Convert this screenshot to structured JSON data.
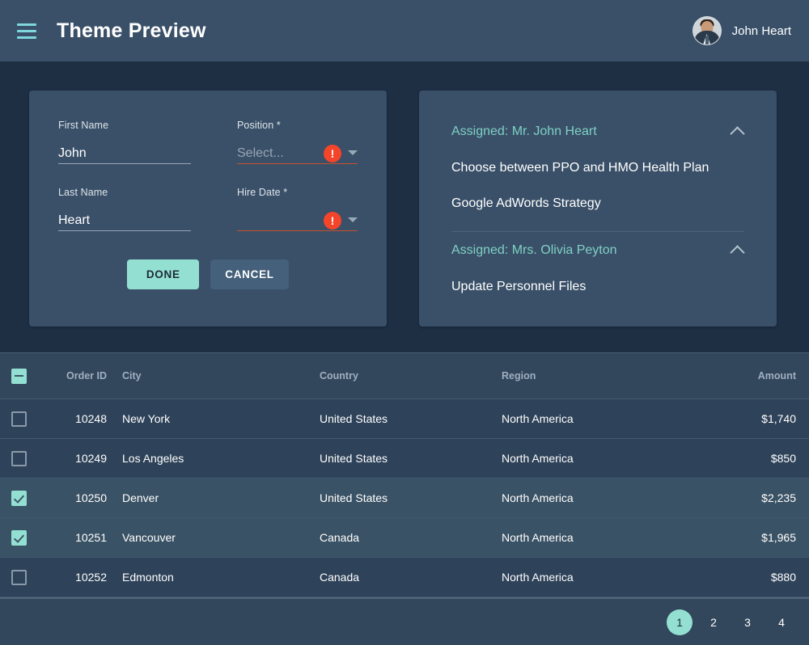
{
  "header": {
    "menu_icon": "hamburger-icon",
    "title": "Theme Preview",
    "user_name": "John Heart",
    "avatar_icon": "user-avatar-photo"
  },
  "form": {
    "fields": {
      "first_name": {
        "label": "First Name",
        "value": "John"
      },
      "last_name": {
        "label": "Last Name",
        "value": "Heart"
      },
      "position": {
        "label": "Position *",
        "placeholder": "Select...",
        "value": "",
        "error_icon": "exclamation-icon",
        "dropdown_icon": "caret-down-icon"
      },
      "hire_date": {
        "label": "Hire Date *",
        "placeholder": "",
        "value": "",
        "error_icon": "exclamation-icon",
        "dropdown_icon": "caret-down-icon"
      }
    },
    "buttons": {
      "done": "DONE",
      "cancel": "CANCEL"
    }
  },
  "tasks": {
    "groups": [
      {
        "title": "Assigned: Mr. John Heart",
        "collapse_icon": "chevron-up-icon",
        "items": [
          "Choose between PPO and HMO Health Plan",
          "Google AdWords Strategy"
        ]
      },
      {
        "title": "Assigned: Mrs. Olivia Peyton",
        "collapse_icon": "chevron-up-icon",
        "items": [
          "Update Personnel Files"
        ]
      }
    ]
  },
  "grid": {
    "select_all_state": "indeterminate",
    "columns": [
      "Order ID",
      "City",
      "Country",
      "Region",
      "Amount"
    ],
    "rows": [
      {
        "selected": false,
        "order_id": "10248",
        "city": "New York",
        "country": "United States",
        "region": "North America",
        "amount": "$1,740"
      },
      {
        "selected": false,
        "order_id": "10249",
        "city": "Los Angeles",
        "country": "United States",
        "region": "North America",
        "amount": "$850"
      },
      {
        "selected": true,
        "order_id": "10250",
        "city": "Denver",
        "country": "United States",
        "region": "North America",
        "amount": "$2,235"
      },
      {
        "selected": true,
        "order_id": "10251",
        "city": "Vancouver",
        "country": "Canada",
        "region": "North America",
        "amount": "$1,965"
      },
      {
        "selected": false,
        "order_id": "10252",
        "city": "Edmonton",
        "country": "Canada",
        "region": "North America",
        "amount": "$880"
      }
    ]
  },
  "pagination": {
    "pages": [
      "1",
      "2",
      "3",
      "4"
    ],
    "active": "1"
  },
  "colors": {
    "page_background": "#1e2f44",
    "surface": "#3a5068",
    "accent": "#93e0d2",
    "accent_text": "#7fd0c4",
    "icon_accent": "#7fd7dc",
    "error": "#f4452a",
    "grid_row": "#2e4259",
    "grid_row_selected": "#3a5265"
  }
}
